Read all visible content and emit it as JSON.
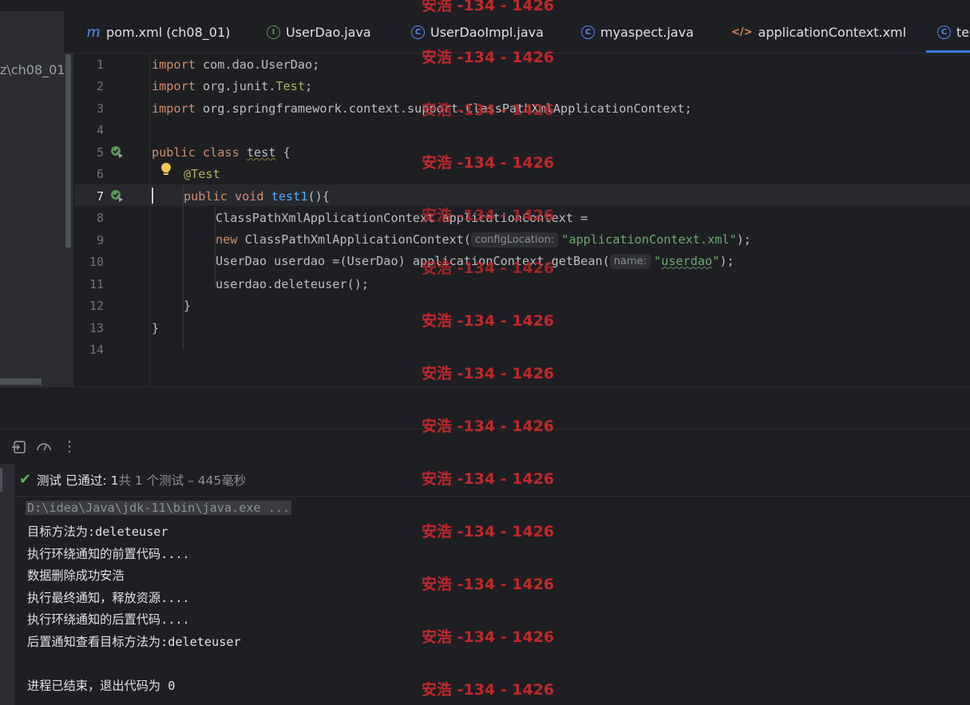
{
  "tabs": [
    {
      "label": "pom.xml (ch08_01)",
      "icon": "maven-icon"
    },
    {
      "label": "UserDao.java",
      "icon": "interface-icon"
    },
    {
      "label": "UserDaoImpl.java",
      "icon": "class-icon"
    },
    {
      "label": "myaspect.java",
      "icon": "class-icon"
    },
    {
      "label": "applicationContext.xml",
      "icon": "xml-icon"
    },
    {
      "label": "te",
      "icon": "class-icon"
    }
  ],
  "project": {
    "breadcrumb": "z\\ch08_01"
  },
  "editor": {
    "line_numbers": [
      "1",
      "2",
      "3",
      "4",
      "5",
      "6",
      "7",
      "8",
      "9",
      "10",
      "11",
      "12",
      "13",
      "14"
    ],
    "lines": {
      "l1_kw": "import",
      "l1_rest": " com.dao.UserDao;",
      "l2_kw": "import",
      "l2_pkg": " org.junit.",
      "l2_cls": "Test",
      "l2_end": ";",
      "l3_kw": "import",
      "l3_rest": " org.springframework.context.support.ClassPathXmlApplicationContext;",
      "l5_kw": "public class",
      "l5_name": "test",
      "l5_end": " {",
      "l6_ann": "@Test",
      "l7_kw": "public void",
      "l7_fn": "test1",
      "l7_end": "(){",
      "l8": "ClassPathXmlApplicationContext applicationContext =",
      "l9_kw": "new",
      "l9_cls": " ClassPathXmlApplicationContext(",
      "l9_hint": "configLocation:",
      "l9_str": "\"applicationContext.xml\"",
      "l9_end": ");",
      "l10_a": "UserDao userdao =(UserDao) applicationContext.getBean(",
      "l10_hint": "name:",
      "l10_q1": "\"",
      "l10_str": "userdao",
      "l10_q2": "\"",
      "l10_end": ");",
      "l11": "userdao.deleteuser();",
      "l12": "}",
      "l13": "}"
    }
  },
  "test_status": {
    "passed_label": "测试 已通过: 1",
    "meta": "共 1 个测试 – 445毫秒"
  },
  "console": [
    "D:\\idea\\Java\\jdk-11\\bin\\java.exe ...",
    "目标方法为:deleteuser",
    "执行环绕通知的前置代码....",
    "数据删除成功安浩",
    "执行最终通知，释放资源....",
    "执行环绕通知的后置代码....",
    "后置通知查看目标方法为:deleteuser",
    "",
    "进程已结束，退出代码为 0"
  ],
  "watermark": "安浩 -134 - 1426",
  "colors": {
    "keyword": "#cf8e6d",
    "annotation": "#b3ae60",
    "function": "#56a8f5",
    "string": "#6aab73",
    "watermark": "#c0282d",
    "accent": "#3574f0"
  }
}
